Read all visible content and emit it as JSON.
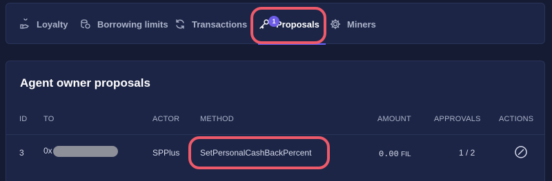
{
  "tabs": [
    {
      "label": "Loyalty",
      "icon": "loyalty-icon"
    },
    {
      "label": "Borrowing limits",
      "icon": "coins-icon"
    },
    {
      "label": "Transactions",
      "icon": "refresh-icon"
    },
    {
      "label": "Proposals",
      "icon": "key-icon",
      "badge": "1",
      "active": true
    },
    {
      "label": "Miners",
      "icon": "gear-icon"
    }
  ],
  "panel": {
    "title": "Agent owner proposals",
    "columns": [
      "ID",
      "TO",
      "ACTOR",
      "METHOD",
      "AMOUNT",
      "APPROVALS",
      "ACTIONS"
    ],
    "rows": [
      {
        "id": "3",
        "to_prefix": "0x",
        "actor": "SPPlus",
        "method": "SetPersonalCashBackPercent",
        "amount": "0.00",
        "amount_unit": "FIL",
        "approvals": "1 / 2",
        "action_icon": "cancel-icon"
      }
    ]
  },
  "colors": {
    "background": "#141b33",
    "panel": "#1c2546",
    "highlight": "#ef5a6a",
    "badge": "#6c5ce7"
  }
}
